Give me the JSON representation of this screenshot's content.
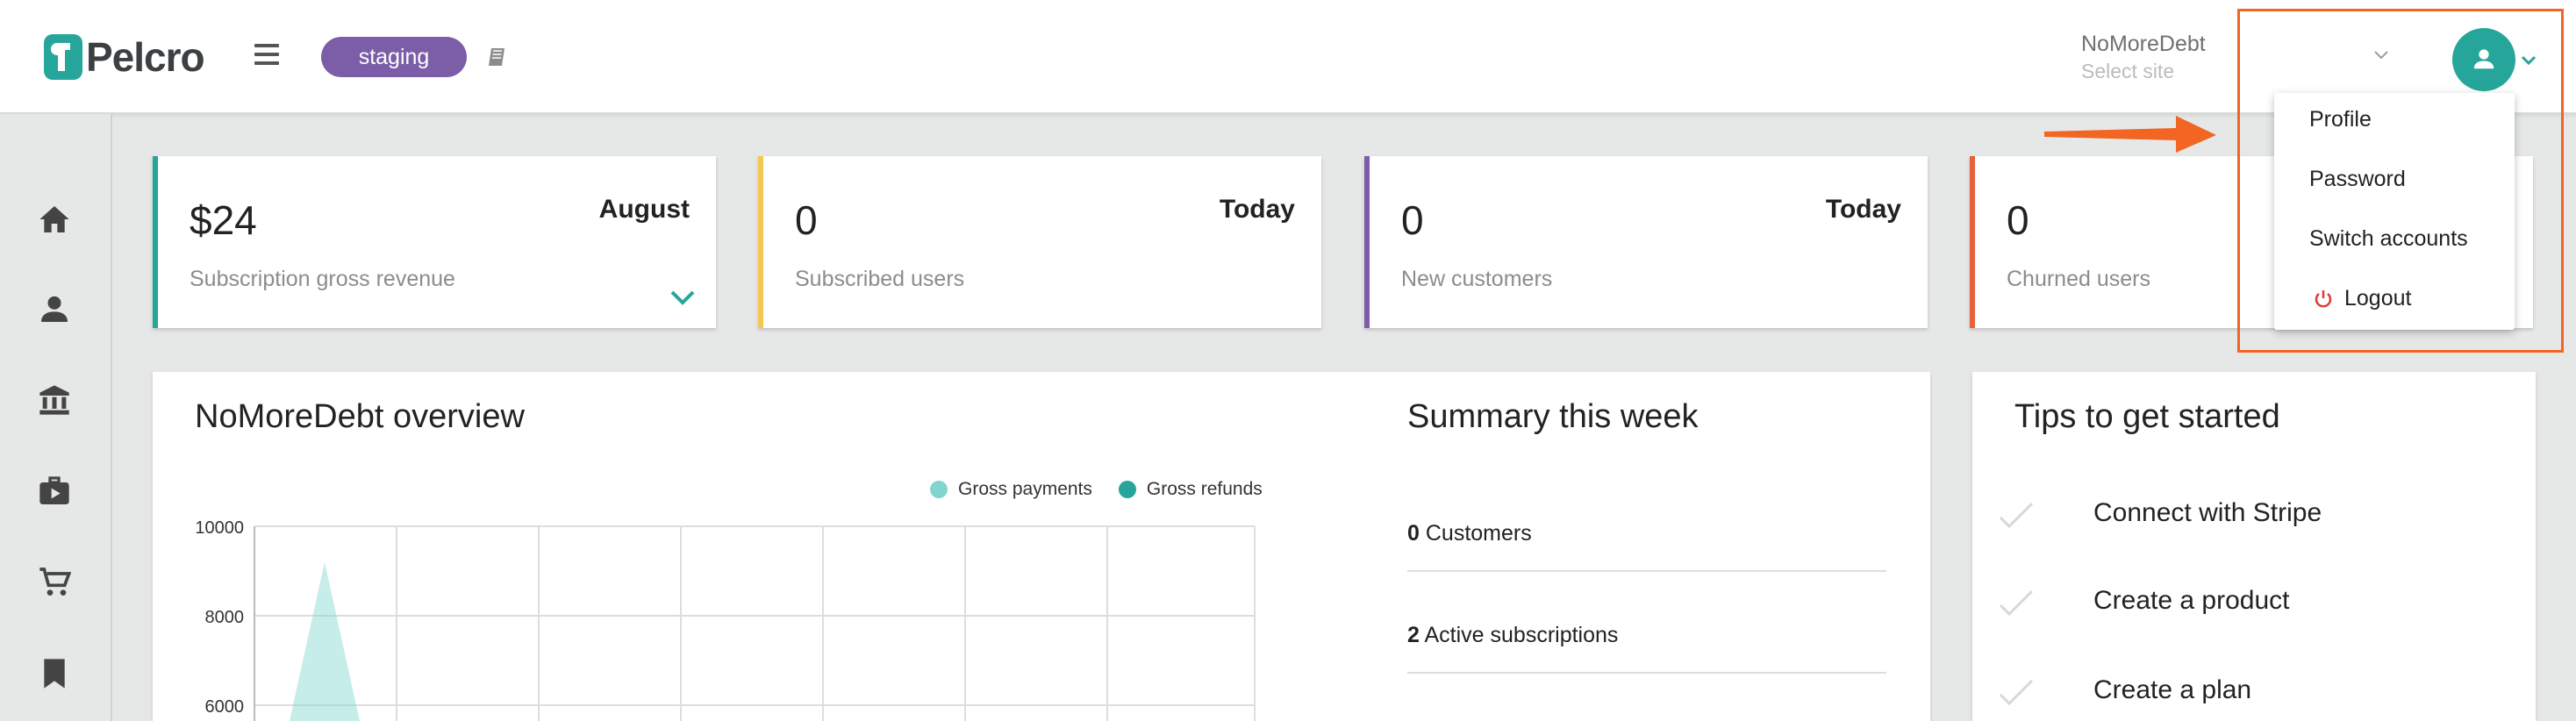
{
  "header": {
    "logo_text": "Pelcro",
    "env_badge": "staging",
    "site_name": "NoMoreDebt",
    "site_select_placeholder": "Select site",
    "brand_color": "#26a69a",
    "badge_color": "#7b5ea7"
  },
  "sidebar": {
    "items": [
      {
        "icon": "home-icon"
      },
      {
        "icon": "person-icon"
      },
      {
        "icon": "bank-icon"
      },
      {
        "icon": "briefcase-play-icon"
      },
      {
        "icon": "cart-icon"
      },
      {
        "icon": "bookmark-icon"
      }
    ]
  },
  "stats": [
    {
      "value": "$24",
      "period": "August",
      "label": "Subscription gross revenue",
      "accent": "#26a69a"
    },
    {
      "value": "0",
      "period": "Today",
      "label": "Subscribed users",
      "accent": "#f4c84f"
    },
    {
      "value": "0",
      "period": "Today",
      "label": "New customers",
      "accent": "#7b5ea7"
    },
    {
      "value": "0",
      "period": "",
      "label": "Churned users",
      "accent": "#e8603c"
    }
  ],
  "overview": {
    "title": "NoMoreDebt overview"
  },
  "chart_data": {
    "type": "area",
    "legend": [
      "Gross payments",
      "Gross refunds"
    ],
    "series_colors": [
      "#80d6cf",
      "#26a69a"
    ],
    "ytick_labels": [
      "10000",
      "8000",
      "6000"
    ],
    "ylim": [
      6000,
      10000
    ],
    "series": [
      {
        "name": "Gross payments",
        "peak_value": 9200
      },
      {
        "name": "Gross refunds",
        "peak_value": 0
      }
    ],
    "grid": true,
    "legend_position": "top-right"
  },
  "summary": {
    "title": "Summary this week",
    "rows": [
      {
        "count": "0",
        "label": "Customers"
      },
      {
        "count": "2",
        "label": "Active subscriptions"
      }
    ]
  },
  "tips": {
    "title": "Tips to get started",
    "items": [
      "Connect with Stripe",
      "Create a product",
      "Create a plan"
    ]
  },
  "user_menu": {
    "items": [
      "Profile",
      "Password",
      "Switch accounts"
    ],
    "logout": "Logout"
  },
  "annotation": {
    "color": "#f26522"
  }
}
